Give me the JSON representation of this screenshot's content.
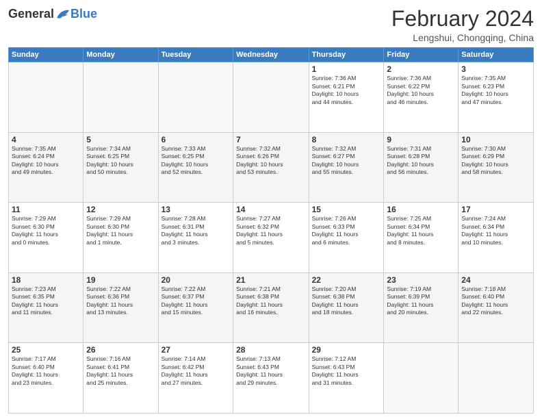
{
  "header": {
    "logo_general": "General",
    "logo_blue": "Blue",
    "month_title": "February 2024",
    "location": "Lengshui, Chongqing, China"
  },
  "weekdays": [
    "Sunday",
    "Monday",
    "Tuesday",
    "Wednesday",
    "Thursday",
    "Friday",
    "Saturday"
  ],
  "weeks": [
    [
      {
        "day": "",
        "info": ""
      },
      {
        "day": "",
        "info": ""
      },
      {
        "day": "",
        "info": ""
      },
      {
        "day": "",
        "info": ""
      },
      {
        "day": "1",
        "info": "Sunrise: 7:36 AM\nSunset: 6:21 PM\nDaylight: 10 hours\nand 44 minutes."
      },
      {
        "day": "2",
        "info": "Sunrise: 7:36 AM\nSunset: 6:22 PM\nDaylight: 10 hours\nand 46 minutes."
      },
      {
        "day": "3",
        "info": "Sunrise: 7:35 AM\nSunset: 6:23 PM\nDaylight: 10 hours\nand 47 minutes."
      }
    ],
    [
      {
        "day": "4",
        "info": "Sunrise: 7:35 AM\nSunset: 6:24 PM\nDaylight: 10 hours\nand 49 minutes."
      },
      {
        "day": "5",
        "info": "Sunrise: 7:34 AM\nSunset: 6:25 PM\nDaylight: 10 hours\nand 50 minutes."
      },
      {
        "day": "6",
        "info": "Sunrise: 7:33 AM\nSunset: 6:25 PM\nDaylight: 10 hours\nand 52 minutes."
      },
      {
        "day": "7",
        "info": "Sunrise: 7:32 AM\nSunset: 6:26 PM\nDaylight: 10 hours\nand 53 minutes."
      },
      {
        "day": "8",
        "info": "Sunrise: 7:32 AM\nSunset: 6:27 PM\nDaylight: 10 hours\nand 55 minutes."
      },
      {
        "day": "9",
        "info": "Sunrise: 7:31 AM\nSunset: 6:28 PM\nDaylight: 10 hours\nand 56 minutes."
      },
      {
        "day": "10",
        "info": "Sunrise: 7:30 AM\nSunset: 6:29 PM\nDaylight: 10 hours\nand 58 minutes."
      }
    ],
    [
      {
        "day": "11",
        "info": "Sunrise: 7:29 AM\nSunset: 6:30 PM\nDaylight: 11 hours\nand 0 minutes."
      },
      {
        "day": "12",
        "info": "Sunrise: 7:29 AM\nSunset: 6:30 PM\nDaylight: 11 hours\nand 1 minute."
      },
      {
        "day": "13",
        "info": "Sunrise: 7:28 AM\nSunset: 6:31 PM\nDaylight: 11 hours\nand 3 minutes."
      },
      {
        "day": "14",
        "info": "Sunrise: 7:27 AM\nSunset: 6:32 PM\nDaylight: 11 hours\nand 5 minutes."
      },
      {
        "day": "15",
        "info": "Sunrise: 7:26 AM\nSunset: 6:33 PM\nDaylight: 11 hours\nand 6 minutes."
      },
      {
        "day": "16",
        "info": "Sunrise: 7:25 AM\nSunset: 6:34 PM\nDaylight: 11 hours\nand 8 minutes."
      },
      {
        "day": "17",
        "info": "Sunrise: 7:24 AM\nSunset: 6:34 PM\nDaylight: 11 hours\nand 10 minutes."
      }
    ],
    [
      {
        "day": "18",
        "info": "Sunrise: 7:23 AM\nSunset: 6:35 PM\nDaylight: 11 hours\nand 11 minutes."
      },
      {
        "day": "19",
        "info": "Sunrise: 7:22 AM\nSunset: 6:36 PM\nDaylight: 11 hours\nand 13 minutes."
      },
      {
        "day": "20",
        "info": "Sunrise: 7:22 AM\nSunset: 6:37 PM\nDaylight: 11 hours\nand 15 minutes."
      },
      {
        "day": "21",
        "info": "Sunrise: 7:21 AM\nSunset: 6:38 PM\nDaylight: 11 hours\nand 16 minutes."
      },
      {
        "day": "22",
        "info": "Sunrise: 7:20 AM\nSunset: 6:38 PM\nDaylight: 11 hours\nand 18 minutes."
      },
      {
        "day": "23",
        "info": "Sunrise: 7:19 AM\nSunset: 6:39 PM\nDaylight: 11 hours\nand 20 minutes."
      },
      {
        "day": "24",
        "info": "Sunrise: 7:18 AM\nSunset: 6:40 PM\nDaylight: 11 hours\nand 22 minutes."
      }
    ],
    [
      {
        "day": "25",
        "info": "Sunrise: 7:17 AM\nSunset: 6:40 PM\nDaylight: 11 hours\nand 23 minutes."
      },
      {
        "day": "26",
        "info": "Sunrise: 7:16 AM\nSunset: 6:41 PM\nDaylight: 11 hours\nand 25 minutes."
      },
      {
        "day": "27",
        "info": "Sunrise: 7:14 AM\nSunset: 6:42 PM\nDaylight: 11 hours\nand 27 minutes."
      },
      {
        "day": "28",
        "info": "Sunrise: 7:13 AM\nSunset: 6:43 PM\nDaylight: 11 hours\nand 29 minutes."
      },
      {
        "day": "29",
        "info": "Sunrise: 7:12 AM\nSunset: 6:43 PM\nDaylight: 11 hours\nand 31 minutes."
      },
      {
        "day": "",
        "info": ""
      },
      {
        "day": "",
        "info": ""
      }
    ]
  ]
}
